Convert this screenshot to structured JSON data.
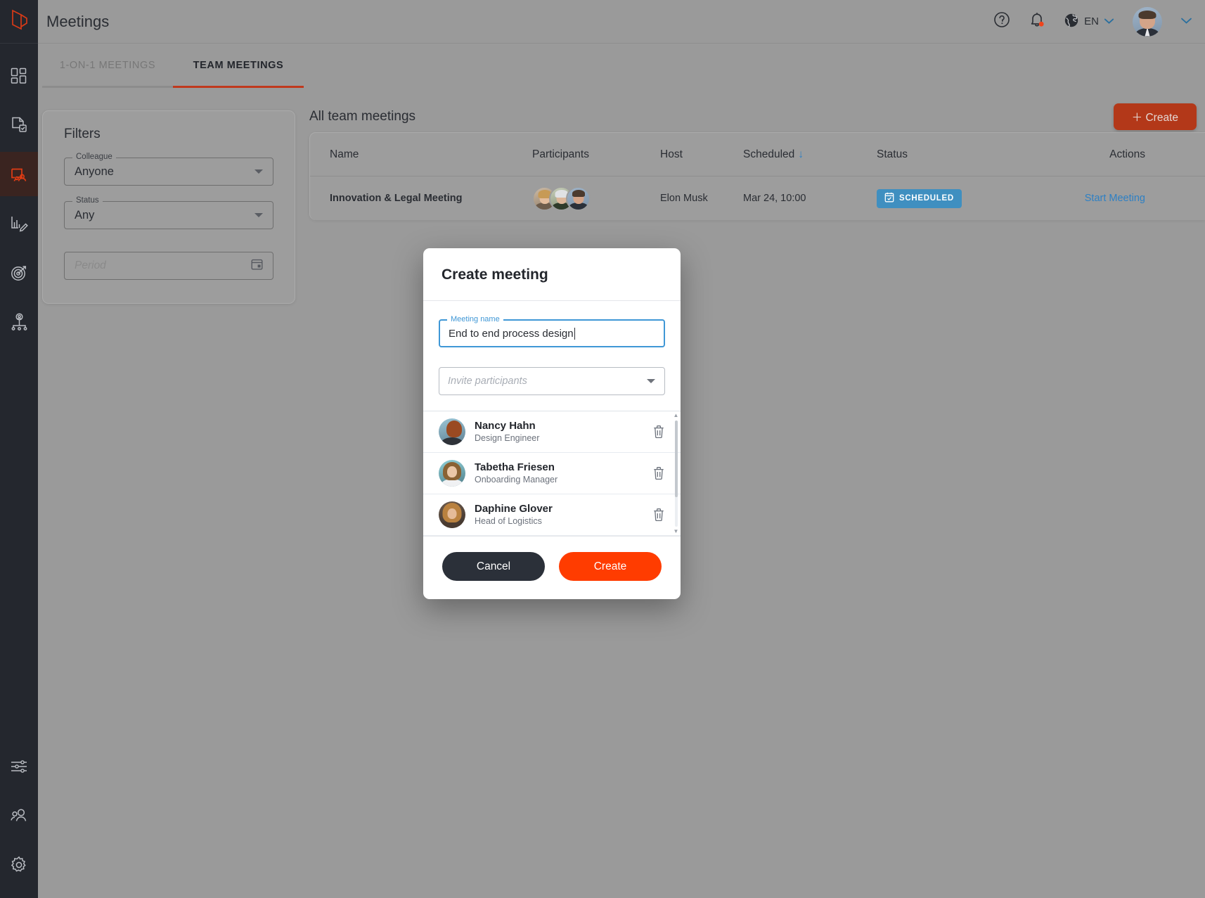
{
  "app": {
    "logo_icon": "brand-logo-icon"
  },
  "header": {
    "title": "Meetings",
    "help_icon": "help-circle-icon",
    "notifications_icon": "bell-icon",
    "globe_icon": "globe-icon",
    "language": "EN",
    "lang_caret_icon": "chevron-down-icon",
    "avatar_caret_icon": "chevron-down-icon"
  },
  "sidebar": {
    "items": [
      {
        "name": "dashboard",
        "icon": "grid-dashboard-icon",
        "active": false
      },
      {
        "name": "documents",
        "icon": "document-check-icon",
        "active": false
      },
      {
        "name": "meetings",
        "icon": "meetings-people-icon",
        "active": true
      },
      {
        "name": "reviews",
        "icon": "chart-edit-icon",
        "active": false
      },
      {
        "name": "goals",
        "icon": "target-icon",
        "active": false
      },
      {
        "name": "org-chart",
        "icon": "org-chart-icon",
        "active": false
      }
    ],
    "bottom_items": [
      {
        "name": "preferences",
        "icon": "sliders-icon"
      },
      {
        "name": "people",
        "icon": "people-icon"
      },
      {
        "name": "settings",
        "icon": "gear-icon"
      }
    ]
  },
  "tabs": [
    {
      "label": "1-ON-1 MEETINGS",
      "active": false
    },
    {
      "label": "TEAM MEETINGS",
      "active": true
    }
  ],
  "filters": {
    "title": "Filters",
    "colleague": {
      "legend": "Colleague",
      "value": "Anyone",
      "caret_icon": "dropdown-caret-icon"
    },
    "status": {
      "legend": "Status",
      "value": "Any",
      "caret_icon": "dropdown-caret-icon"
    },
    "period": {
      "placeholder": "Period",
      "calendar_icon": "calendar-icon"
    }
  },
  "main": {
    "section_title": "All team meetings",
    "create_button": "＋ Create",
    "columns": [
      "Name",
      "Participants",
      "Host",
      "Scheduled",
      "Status",
      "Actions"
    ],
    "sort_column": "Scheduled",
    "sort_icon": "arrow-down-icon",
    "rows": [
      {
        "name": "Innovation & Legal Meeting",
        "participant_count": 3,
        "host": "Elon Musk",
        "scheduled": "Mar 24, 10:00",
        "status": "SCHEDULED",
        "status_icon": "calendar-check-icon",
        "action": "Start Meeting"
      }
    ]
  },
  "modal": {
    "title": "Create meeting",
    "meeting_name": {
      "legend": "Meeting name",
      "value": "End to end process design"
    },
    "invite": {
      "placeholder": "Invite participants",
      "caret_icon": "dropdown-caret-icon"
    },
    "participants": [
      {
        "name": "Nancy Hahn",
        "role": "Design Engineer",
        "delete_icon": "trash-icon"
      },
      {
        "name": "Tabetha Friesen",
        "role": "Onboarding Manager",
        "delete_icon": "trash-icon"
      },
      {
        "name": "Daphine Glover",
        "role": "Head of Logistics",
        "delete_icon": "trash-icon"
      }
    ],
    "scroll_up_icon": "scroll-up-arrow-icon",
    "scroll_down_icon": "scroll-down-arrow-icon",
    "cancel_button": "Cancel",
    "create_button": "Create"
  },
  "colors": {
    "brand_orange": "#ff3c00",
    "create_btn_table": "#b33819",
    "sidebar_bg": "#24272e",
    "tab_active_underline": "#c0391d",
    "status_badge": "#3f8fc0",
    "link_blue": "#2e80c4",
    "focus_blue": "#3f97d6",
    "cancel_dark": "#2b3039"
  }
}
